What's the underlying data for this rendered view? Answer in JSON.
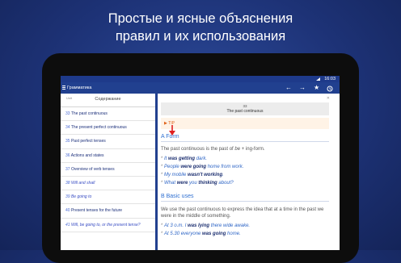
{
  "promo": {
    "line1": "Простые и ясные объяснения",
    "line2": "правил и их использования"
  },
  "status": {
    "time": "16:03"
  },
  "appbar": {
    "title": "Грамматика",
    "icons": [
      "back-arrow-icon",
      "forward-arrow-icon",
      "star-icon",
      "history-icon"
    ],
    "back": "←",
    "forward": "→",
    "star": "★"
  },
  "toc": {
    "search_hint": "Unit",
    "title": "Содержание",
    "items": [
      {
        "num": "33",
        "text": "The past continuous"
      },
      {
        "num": "34",
        "text": "The present perfect continuous"
      },
      {
        "num": "35",
        "text": "Past perfect tenses"
      },
      {
        "num": "36",
        "text": "Actions and states"
      },
      {
        "num": "37",
        "text": "Overview of verb tenses"
      },
      {
        "num": "38",
        "text": "Will and shall",
        "italic": true
      },
      {
        "num": "39",
        "text": "Be going to",
        "italic": true
      },
      {
        "num": "40",
        "text": "Present tenses for the future"
      },
      {
        "num": "41",
        "text": "Will, be going to, or the present tense?",
        "italic": true
      }
    ]
  },
  "content": {
    "unit_num": "33",
    "unit_name": "The past continuous",
    "tip": "▶ TIP",
    "section_a": "A Form",
    "form_pre": "The past continuous is the past of ",
    "form_be": "be",
    "form_post": " + ing-form.",
    "examples": [
      {
        "pre": "It ",
        "bold": "was getting",
        "post": " dark."
      },
      {
        "pre": "People ",
        "bold": "were going",
        "post": " home from work."
      },
      {
        "pre": "My mobile ",
        "bold": "wasn't working",
        "post": "."
      },
      {
        "pre": "What ",
        "bold": "were",
        "mid": " you ",
        "bold2": "thinking",
        "post": " about?"
      }
    ],
    "section_b": "B Basic uses",
    "use_line1": "We use the past continuous to express the idea that at a time in the past we",
    "use_line2": "were in the middle of something.",
    "examples_b": [
      {
        "pre": "At 3 o.m. I ",
        "bold": "was lying",
        "post": " there wide awake."
      },
      {
        "pre": "At 5.30 everyone ",
        "bold": "was going",
        "post": " home."
      }
    ]
  }
}
